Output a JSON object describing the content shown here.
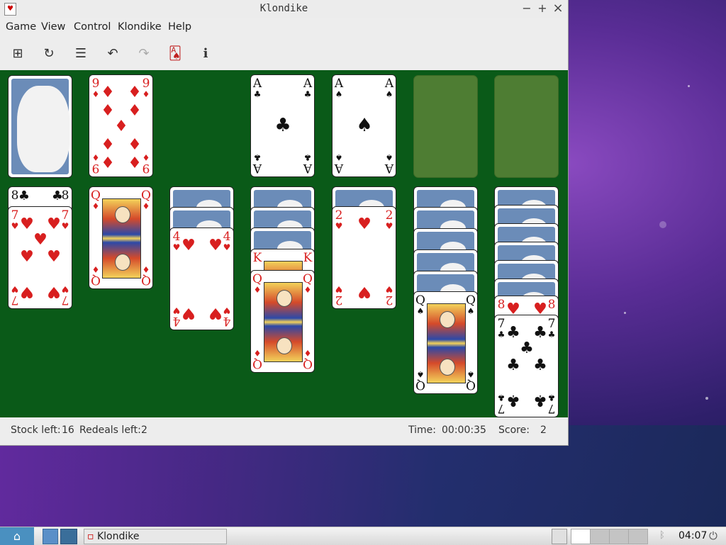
{
  "window": {
    "title": "Klondike",
    "app_icon": "♥",
    "minimize": "−",
    "maximize": "+",
    "close": "×"
  },
  "menu": [
    "Game",
    "View",
    "Control",
    "Klondike",
    "Help"
  ],
  "toolbar": {
    "new_game": "⊞",
    "restart": "↻",
    "select_game": "☰",
    "undo": "↶",
    "redo": "↷",
    "deal": "🂡",
    "info": "i"
  },
  "cards": {
    "waste_top": {
      "rank": "9",
      "suit": "♦"
    },
    "foundation_1": {
      "rank": "A",
      "suit": "♣"
    },
    "foundation_2": {
      "rank": "A",
      "suit": "♠"
    },
    "t1_hidden": {
      "rank": "8",
      "suit": "♣"
    },
    "t1_top": {
      "rank": "7",
      "suit": "♥"
    },
    "t2_top": {
      "rank": "Q",
      "suit": "♦"
    },
    "t3_top": {
      "rank": "4",
      "suit": "♥"
    },
    "t4_mid": {
      "rank": "K",
      "suit": "♦"
    },
    "t4_top": {
      "rank": "Q",
      "suit": "♦"
    },
    "t5_top": {
      "rank": "2",
      "suit": "♥"
    },
    "t6_top": {
      "rank": "Q",
      "suit": "♠"
    },
    "t7_mid": {
      "rank": "8",
      "suit": "♥"
    },
    "t7_top": {
      "rank": "7",
      "suit": "♣"
    }
  },
  "status": {
    "stock_label": "Stock left:",
    "stock_value": "16",
    "redeals_label": "Redeals left:",
    "redeals_value": "2",
    "time_label": "Time:",
    "time_value": "00:00:35",
    "score_label": "Score:",
    "score_value": "2"
  },
  "taskbar": {
    "task_label": "Klondike",
    "clock": "04:07"
  },
  "colors": {
    "felt": "#0a5a18",
    "card_back": "#6b8cb8",
    "empty_slot": "#4e7d33",
    "red_suit": "#d81f1f"
  }
}
